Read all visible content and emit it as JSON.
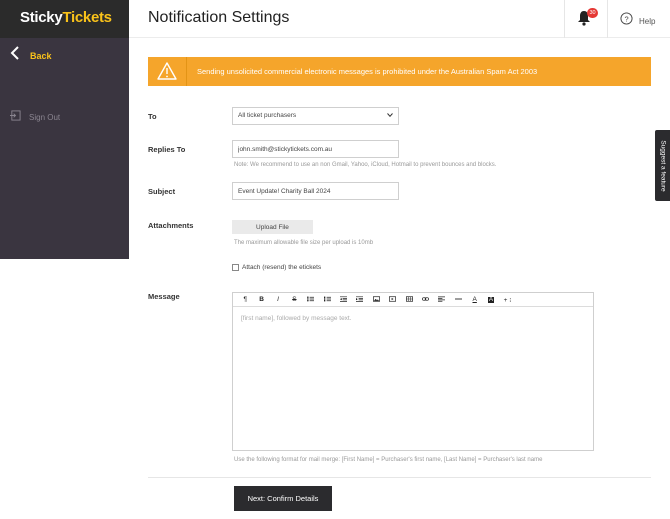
{
  "brand": {
    "part1": "Sticky",
    "part2": "Tickets",
    "accent": "#f9c21a"
  },
  "sidebar": {
    "back_label": "Back",
    "signout_label": "Sign Out"
  },
  "header": {
    "title": "Notification Settings",
    "notification_count": "30",
    "help_label": "Help"
  },
  "warning": {
    "text": "Sending unsolicited commercial electronic messages is prohibited under the Australian Spam Act 2003",
    "color": "#f5a52b"
  },
  "form": {
    "to": {
      "label": "To",
      "value": "All ticket purchasers"
    },
    "replies_to": {
      "label": "Replies To",
      "value": "john.smith@stickytickets.com.au",
      "note": "Note: We recommend to use an non Gmail, Yahoo, iCloud, Hotmail to prevent bounces and blocks."
    },
    "subject": {
      "label": "Subject",
      "value": "Event Update! Charity Ball 2024"
    },
    "attachments": {
      "label": "Attachments",
      "button": "Upload File",
      "note": "The maximum allowable file size per upload is 10mb"
    },
    "attach_etickets": {
      "label": "Attach (resend) the etickets",
      "checked": false
    },
    "message": {
      "label": "Message",
      "placeholder": "[first name], followed by message text.",
      "mail_merge_note": "Use the following format for mail merge: [First Name] = Purchaser's first name, [Last Name] = Purchaser's last name"
    }
  },
  "toolbar": {
    "paragraph": "¶",
    "bold": "B",
    "italic": "I",
    "strike": "S",
    "font_color": "A",
    "background_color": "A",
    "more": "+ ⁝"
  },
  "actions": {
    "confirm_label": "Next: Confirm Details"
  },
  "suggest": {
    "label": "Suggest a feature"
  }
}
